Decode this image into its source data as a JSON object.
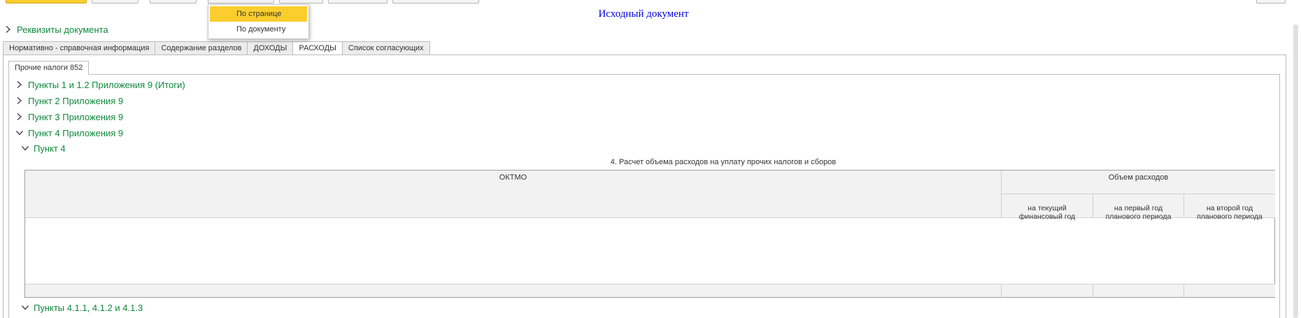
{
  "toolbar": {
    "buttons": [
      "save-button",
      "button-2",
      "button-3",
      "scale-dropdown-button",
      "button-5",
      "button-6",
      "button-7"
    ]
  },
  "scale_menu": {
    "items": [
      "По странице",
      "По документу"
    ],
    "selected": "По странице"
  },
  "document": {
    "title": "Исходный документ",
    "requisites_label": "Реквизиты документа"
  },
  "tabs": [
    {
      "label": "Нормативно - справочная информация",
      "active": false
    },
    {
      "label": "Содержание разделов",
      "active": false
    },
    {
      "label": "ДОХОДЫ",
      "active": false
    },
    {
      "label": "РАСХОДЫ",
      "active": true
    },
    {
      "label": "Список согласующих",
      "active": false
    }
  ],
  "subtab": {
    "label": "Прочие налоги 852"
  },
  "sections": [
    {
      "label": "Пункты 1 и 1.2 Приложения 9 (Итоги)",
      "expanded": false
    },
    {
      "label": "Пункт 2 Приложения 9",
      "expanded": false
    },
    {
      "label": "Пункт 3 Приложения 9",
      "expanded": false
    },
    {
      "label": "Пункт 4 Приложения 9",
      "expanded": true
    }
  ],
  "subsection": {
    "label": "Пункт 4",
    "expanded": true
  },
  "table": {
    "caption": "4. Расчет объема расходов на уплату прочих налогов и сборов",
    "col_oktmo": "ОКТМО",
    "col_group": "Объем расходов",
    "col_current": "на текущий\nфинансовый год",
    "col_first": "на первый год\nпланового периода",
    "col_second": "на второй год\nпланового периода"
  },
  "next_section": {
    "label": "Пункты 4.1.1, 4.1.2 и 4.1.3",
    "expanded": true
  },
  "colors": {
    "accent": "#fbce2e",
    "link": "#0e8a3c",
    "title": "#0000dd"
  }
}
